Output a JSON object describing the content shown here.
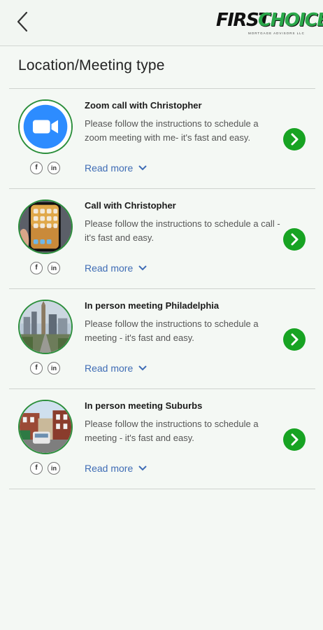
{
  "header": {
    "back_icon": "chevron-left-icon",
    "logo_word1": "FIRST",
    "logo_word2": "CHOICE",
    "logo_tagline": "MORTGAGE ADVISORS LLC"
  },
  "page_title": "Location/Meeting type",
  "colors": {
    "accent_green": "#17a322",
    "link_blue": "#3f6cb5",
    "zoom_blue": "#2d8cff"
  },
  "meetings": [
    {
      "title": "Zoom call with Christopher",
      "description": "Please follow the instructions to schedule a zoom meeting with me- it's fast and easy.",
      "read_more": "Read more",
      "image": "zoom-logo-icon",
      "social": [
        "f",
        "in"
      ]
    },
    {
      "title": "Call with Christopher",
      "description": "Please follow the instructions to schedule a call - it's fast and easy.",
      "read_more": "Read more",
      "image": "smartphone-photo",
      "social": [
        "f",
        "in"
      ]
    },
    {
      "title": "In person meeting Philadelphia",
      "description": "Please follow the instructions to schedule a meeting - it's fast and easy.",
      "read_more": "Read more",
      "image": "philadelphia-skyline-photo",
      "social": [
        "f",
        "in"
      ]
    },
    {
      "title": "In person meeting Suburbs",
      "description": "Please follow the instructions to schedule a meeting - it's fast and easy.",
      "read_more": "Read more",
      "image": "suburb-street-photo",
      "social": [
        "f",
        "in"
      ]
    }
  ]
}
